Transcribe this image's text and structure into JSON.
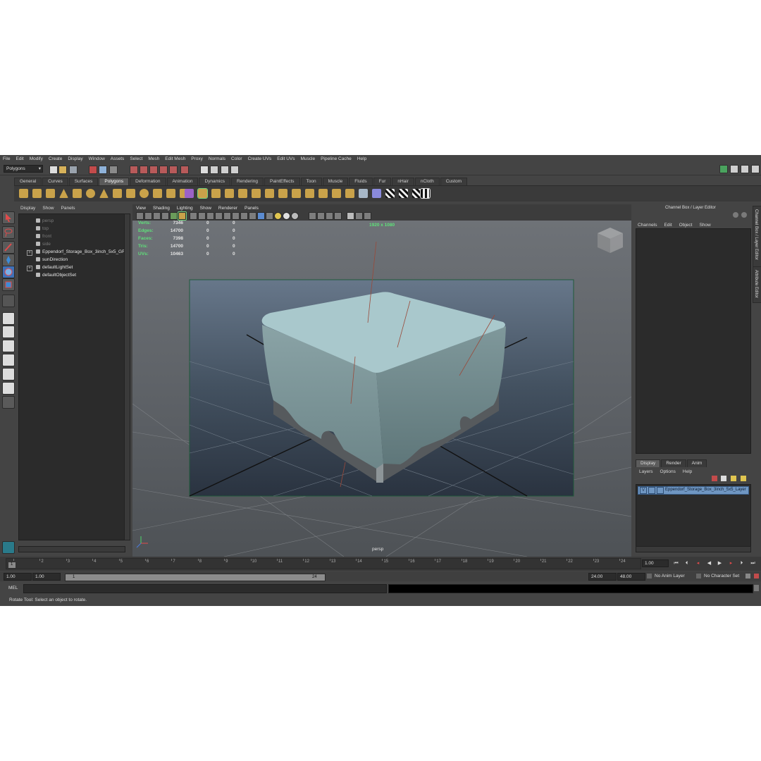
{
  "menubar": [
    "File",
    "Edit",
    "Modify",
    "Create",
    "Display",
    "Window",
    "Assets",
    "Select",
    "Mesh",
    "Edit Mesh",
    "Proxy",
    "Normals",
    "Color",
    "Create UVs",
    "Edit UVs",
    "Muscle",
    "Pipeline Cache",
    "Help"
  ],
  "status": {
    "mode_select": "Polygons"
  },
  "shelf_tabs": [
    "General",
    "Curves",
    "Surfaces",
    "Polygons",
    "Deformation",
    "Animation",
    "Dynamics",
    "Rendering",
    "PaintEffects",
    "Toon",
    "Muscle",
    "Fluids",
    "Fur",
    "nHair",
    "nCloth",
    "Custom"
  ],
  "shelf_active": "Polygons",
  "outliner": {
    "menu": [
      "Display",
      "Show",
      "Panels"
    ],
    "items": [
      {
        "label": "persp",
        "style": "dim"
      },
      {
        "label": "top",
        "style": "dim"
      },
      {
        "label": "front",
        "style": "dim"
      },
      {
        "label": "side",
        "style": "dim"
      },
      {
        "label": "Eppendorf_Storage_Box_3inch_5x5_GRP",
        "style": "bright"
      },
      {
        "label": "sunDirection",
        "style": "bright"
      },
      {
        "label": "defaultLightSet",
        "style": "bright"
      },
      {
        "label": "defaultObjectSet",
        "style": "bright"
      }
    ]
  },
  "viewport": {
    "menu": [
      "View",
      "Shading",
      "Lighting",
      "Show",
      "Renderer",
      "Panels"
    ],
    "hud": [
      {
        "label": "Verts:",
        "v1": "7346",
        "v2": "0",
        "v3": "0"
      },
      {
        "label": "Edges:",
        "v1": "14700",
        "v2": "0",
        "v3": "0"
      },
      {
        "label": "Faces:",
        "v1": "7398",
        "v2": "0",
        "v3": "0"
      },
      {
        "label": "Tris:",
        "v1": "14700",
        "v2": "0",
        "v3": "0"
      },
      {
        "label": "UVs:",
        "v1": "10463",
        "v2": "0",
        "v3": "0"
      }
    ],
    "resolution": "1920 x 1080",
    "camera": "persp",
    "colors": {
      "hud_label": "#5fe27a",
      "box_top": "#a9c8cc",
      "box_side": "#7c9599",
      "gate_border": "#1f5a3a"
    }
  },
  "channelbox": {
    "title": "Channel Box / Layer Editor",
    "menu": [
      "Channels",
      "Edit",
      "Object",
      "Show"
    ]
  },
  "side_tabs": [
    "Channel Box / Layer Editor",
    "Attribute Editor"
  ],
  "layers": {
    "tabs": [
      "Display",
      "Render",
      "Anim"
    ],
    "menu": [
      "Layers",
      "Options",
      "Help"
    ],
    "row_visibility": "V",
    "row_label": "Eppendorf_Storage_Box_3inch_5x5_Layer"
  },
  "timeline": {
    "ticks": [
      "1",
      "2",
      "3",
      "4",
      "5",
      "6",
      "7",
      "8",
      "9",
      "10",
      "11",
      "12",
      "13",
      "14",
      "15",
      "16",
      "17",
      "18",
      "19",
      "20",
      "21",
      "22",
      "23",
      "24"
    ],
    "current_frame": "1",
    "current_field": "1.00"
  },
  "range": {
    "start": "1.00",
    "playback_start": "1.00",
    "slider_start": "1",
    "slider_end": "24",
    "playback_end": "24.00",
    "end": "48.00",
    "anim_layer": "No Anim Layer",
    "char_set": "No Character Set"
  },
  "command": {
    "label": "MEL"
  },
  "help_text": "Rotate Tool: Select an object to rotate."
}
